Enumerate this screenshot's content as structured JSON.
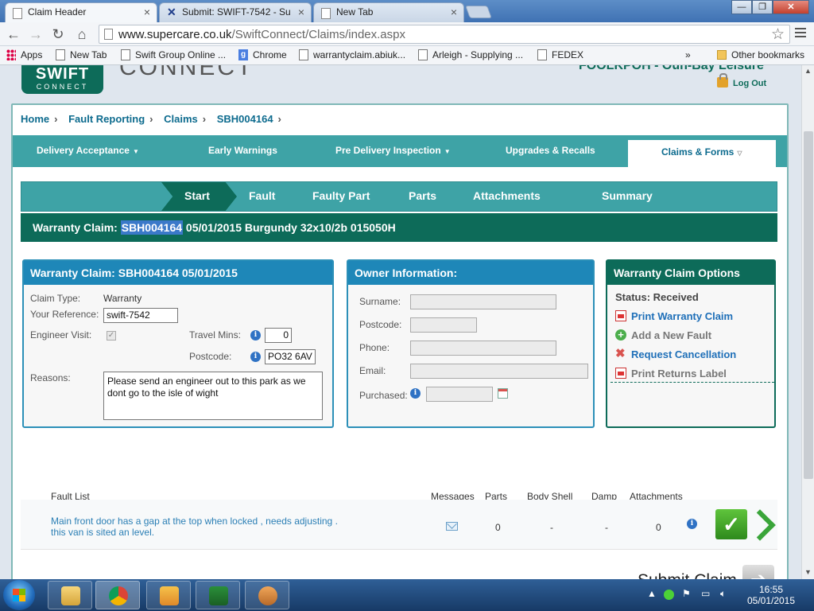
{
  "browser": {
    "tabs": [
      {
        "title": "Claim Header",
        "close": "×"
      },
      {
        "title": "Submit:  SWIFT-7542 - Su",
        "close": "×"
      },
      {
        "title": "New Tab",
        "close": "×"
      }
    ],
    "url_host": "www.supercare.co.uk",
    "url_path": "/SwiftConnect/Claims/index.aspx",
    "bookmarks": [
      "Apps",
      "New Tab",
      "Swift Group Online ...",
      "Chrome",
      "warrantyclaim.abiuk...",
      "Arleigh - Supplying ...",
      "FEDEX",
      "»",
      "Other bookmarks"
    ]
  },
  "header": {
    "logo_top": "SWIFT",
    "logo_bottom": "CONNECT",
    "logo_ghost": "CONNECT",
    "dealer": "FOOLKPOH - Oun-Bay Leisure",
    "logout": "Log Out"
  },
  "breadcrumb": [
    "Home",
    "Fault Reporting",
    "Claims",
    "SBH004164"
  ],
  "breadcrumb_sep": "›",
  "nav": [
    {
      "label": "Delivery Acceptance",
      "caret": "▼"
    },
    {
      "label": "Early Warnings",
      "caret": ""
    },
    {
      "label": "Pre Delivery Inspection",
      "caret": "▼"
    },
    {
      "label": "Upgrades & Recalls",
      "caret": ""
    },
    {
      "label": "Claims & Forms",
      "caret": "▽"
    }
  ],
  "steps": [
    "Start",
    "Fault",
    "Faulty Part",
    "Parts",
    "Attachments",
    "Summary"
  ],
  "claimbar": {
    "prefix": "Warranty Claim:",
    "id": "SBH004164",
    "suffix": "05/01/2015 Burgundy 32x10/2b 015050H"
  },
  "claim_panel": {
    "title": "Warranty Claim: SBH004164 05/01/2015",
    "claim_type_label": "Claim Type:",
    "claim_type": "Warranty",
    "your_ref_label": "Your Reference:",
    "your_ref": "swift-7542",
    "engineer_visit_label": "Engineer Visit:",
    "engineer_visit_check": "✓",
    "travel_mins_label": "Travel Mins:",
    "travel_mins": "0",
    "postcode_label": "Postcode:",
    "postcode": "PO32 6AV",
    "reasons_label": "Reasons:",
    "reasons": "Please send an engineer out to this park as we dont go to the isle of wight"
  },
  "owner_panel": {
    "title": "Owner Information:",
    "surname_label": "Surname:",
    "postcode_label": "Postcode:",
    "phone_label": "Phone:",
    "email_label": "Email:",
    "purchased_label": "Purchased:"
  },
  "options_panel": {
    "title": "Warranty Claim Options",
    "status": "Status: Received",
    "print_claim": "Print Warranty Claim",
    "add_fault": "Add a New Fault",
    "request_cancel": "Request Cancellation",
    "print_returns": "Print Returns Label"
  },
  "fault_list": {
    "headers": [
      "Fault List",
      "Messages",
      "Parts",
      "Body Shell",
      "Damp",
      "Attachments"
    ],
    "rows": [
      {
        "line1": "Main front door has a gap at the top when locked , needs adjusting .",
        "line2": "this van is sited an level.",
        "parts": "0",
        "body_shell": "-",
        "damp": "-",
        "attachments": "0",
        "check": "✓"
      }
    ]
  },
  "submit_label": "Submit Claim",
  "info_glyph": "i",
  "taskbar": {
    "time": "16:55",
    "date": "05/01/2015"
  },
  "icons": [
    "swift-tab-icon",
    "star-icon",
    "menu-icon",
    "lock-icon",
    "info-icon",
    "calendar-icon",
    "pdf-icon",
    "plus-icon",
    "x-icon",
    "mail-icon",
    "check-icon",
    "next-arrow-icon"
  ]
}
